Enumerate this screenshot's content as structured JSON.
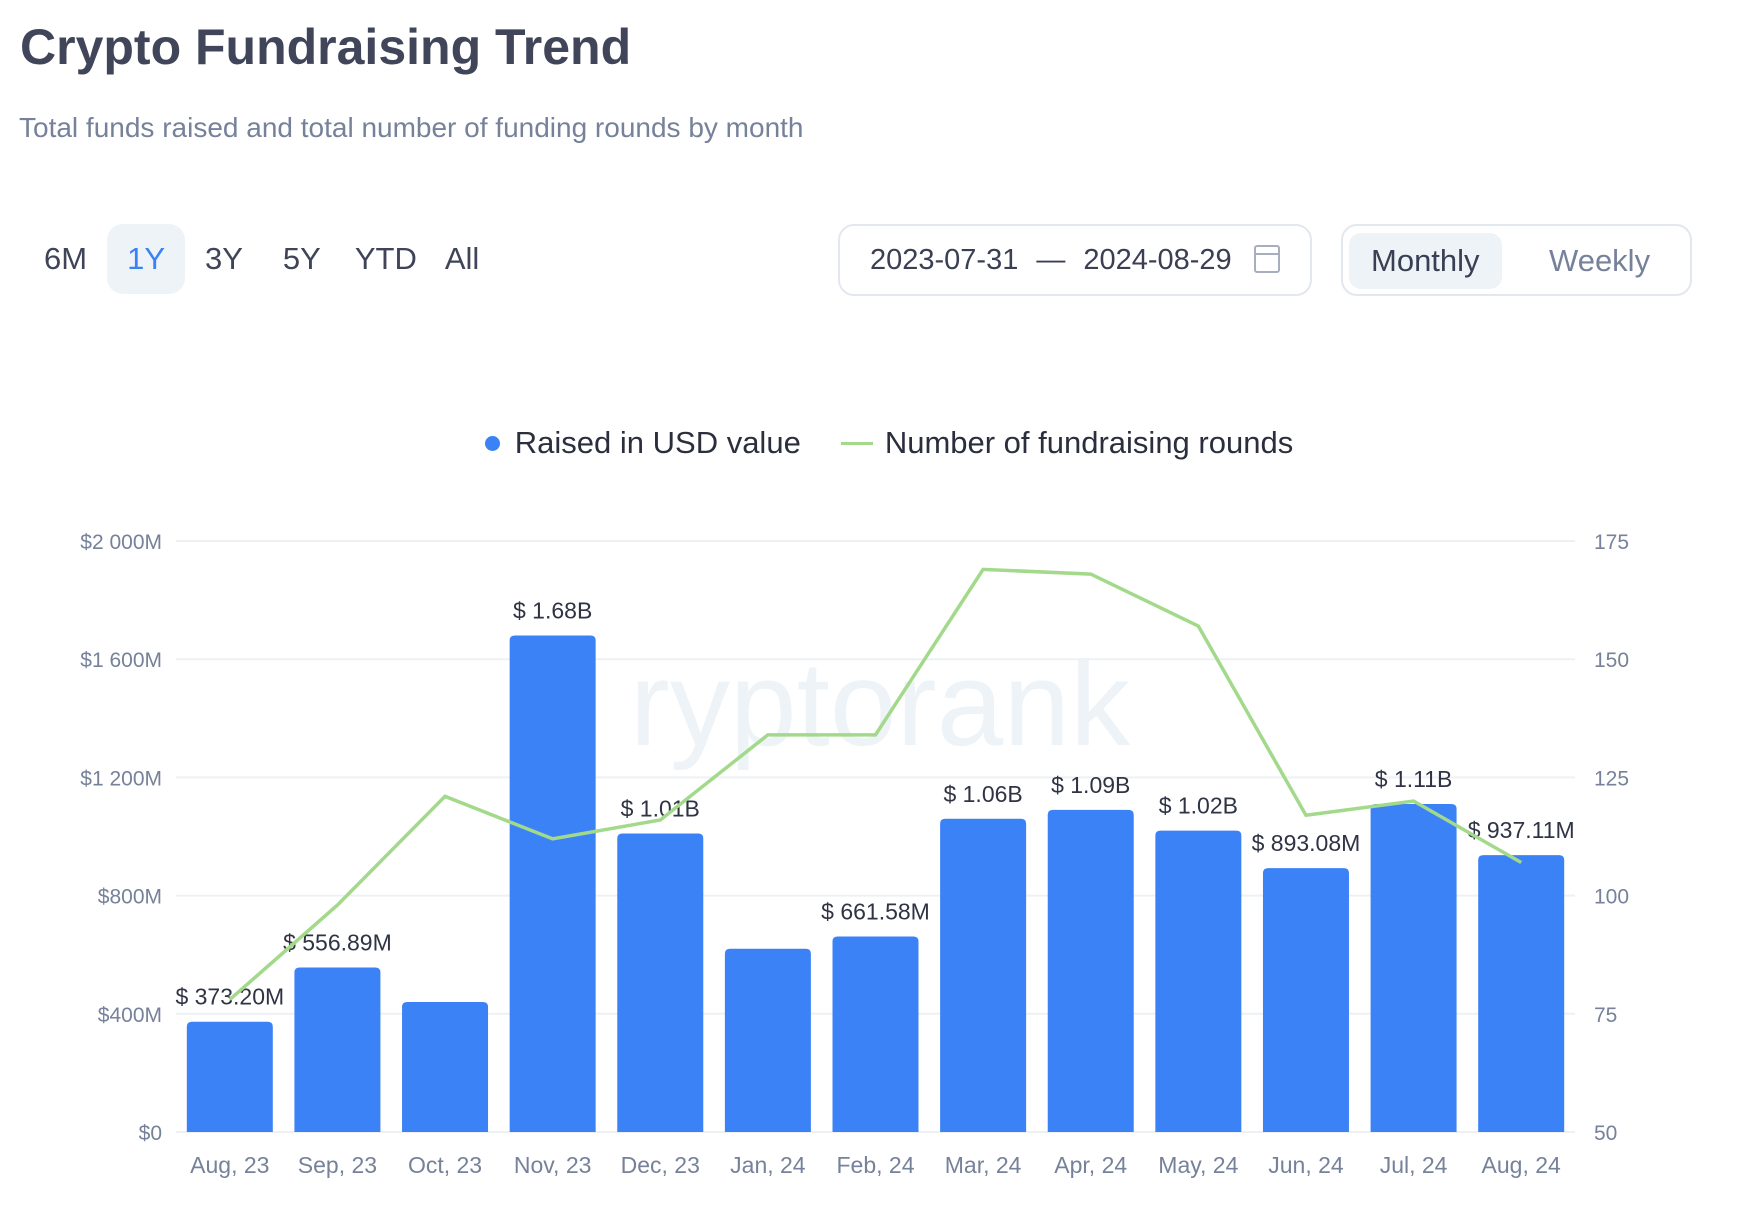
{
  "header": {
    "title": "Crypto Fundraising Trend",
    "subtitle": "Total funds raised and total number of funding rounds by month"
  },
  "controls": {
    "ranges": [
      "6M",
      "1Y",
      "3Y",
      "5Y",
      "YTD",
      "All"
    ],
    "active_range": "1Y",
    "date_from": "2023-07-31",
    "date_separator": "—",
    "date_to": "2024-08-29",
    "calendar_icon": "calendar-icon",
    "granularity": [
      "Monthly",
      "Weekly"
    ],
    "active_granularity": "Monthly"
  },
  "colors": {
    "bars": "#3b82f6",
    "line": "#a3d98a",
    "accent": "#3b82f6"
  },
  "chart_data": {
    "type": "bar+line",
    "categories": [
      "Aug, 23",
      "Sep, 23",
      "Oct, 23",
      "Nov, 23",
      "Dec, 23",
      "Jan, 24",
      "Feb, 24",
      "Mar, 24",
      "Apr, 24",
      "May, 24",
      "Jun, 24",
      "Jul, 24",
      "Aug, 24"
    ],
    "series": [
      {
        "name": "Raised in USD value",
        "type": "bar",
        "axis": "left",
        "unit": "USD M",
        "values": [
          373.2,
          556.89,
          440,
          1680,
          1010,
          620,
          661.58,
          1060,
          1090,
          1020,
          893.08,
          1110,
          937.11
        ],
        "labels": [
          "$ 373.20M",
          "$ 556.89M",
          "",
          "$ 1.68B",
          "$ 1.01B",
          "",
          "$ 661.58M",
          "$ 1.06B",
          "$ 1.09B",
          "$ 1.02B",
          "$ 893.08M",
          "$ 1.11B",
          "$ 937.11M"
        ]
      },
      {
        "name": "Number of fundraising rounds",
        "type": "line",
        "axis": "right",
        "values": [
          78,
          98,
          121,
          112,
          116,
          134,
          134,
          169,
          168,
          157,
          117,
          120,
          107
        ]
      }
    ],
    "y_left": {
      "range": [
        0,
        2000
      ],
      "ticks": [
        0,
        400,
        800,
        1200,
        1600,
        2000
      ],
      "tick_labels": [
        "$0",
        "$400M",
        "$800M",
        "$1 200M",
        "$1 600M",
        "$2 000M"
      ]
    },
    "y_right": {
      "range": [
        50,
        175
      ],
      "ticks": [
        50,
        75,
        100,
        125,
        150,
        175
      ],
      "tick_labels": [
        "50",
        "75",
        "100",
        "125",
        "150",
        "175"
      ]
    },
    "grid": true,
    "legend": "top-center",
    "watermark": "cryptorank"
  }
}
